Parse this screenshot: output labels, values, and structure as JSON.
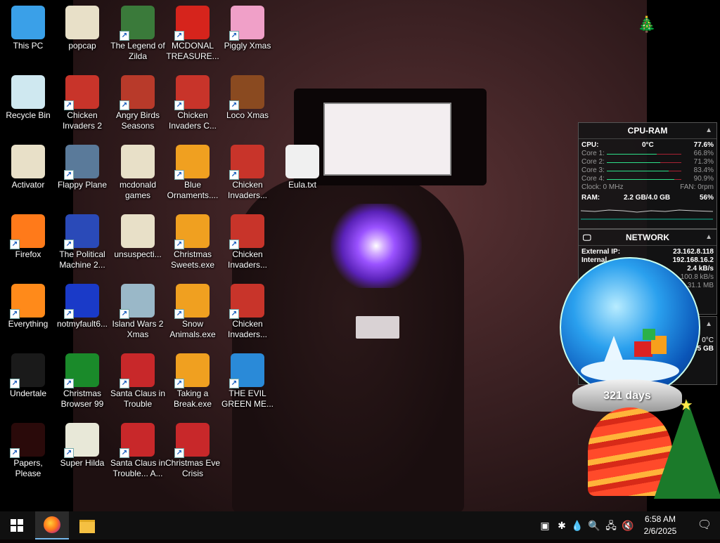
{
  "desktop": {
    "icons": [
      {
        "label": "This PC",
        "icon": "computer-icon"
      },
      {
        "label": "popcap",
        "icon": "folder-icon"
      },
      {
        "label": "The Legend of Zilda",
        "icon": "game-icon"
      },
      {
        "label": "MCDONAL TREASURE...",
        "icon": "mcdonalds-icon"
      },
      {
        "label": "Piggly Xmas",
        "icon": "pig-icon"
      },
      {
        "label": "Recycle Bin",
        "icon": "recycle-bin-icon"
      },
      {
        "label": "Chicken Invaders 2",
        "icon": "chicken-icon"
      },
      {
        "label": "Angry Birds Seasons",
        "icon": "angry-birds-icon"
      },
      {
        "label": "Chicken Invaders C...",
        "icon": "chicken-icon"
      },
      {
        "label": "Loco Xmas",
        "icon": "bear-icon"
      },
      {
        "label": "Activator",
        "icon": "folder-icon"
      },
      {
        "label": "Flappy Plane",
        "icon": "plane-icon"
      },
      {
        "label": "mcdonald games",
        "icon": "folder-icon"
      },
      {
        "label": "Blue Ornaments....",
        "icon": "exe-icon"
      },
      {
        "label": "Chicken Invaders...",
        "icon": "chicken-icon"
      },
      {
        "label": "Eula.txt",
        "icon": "text-file-icon"
      },
      {
        "label": "Firefox",
        "icon": "firefox-icon"
      },
      {
        "label": "The Political Machine 2...",
        "icon": "political-machine-icon"
      },
      {
        "label": "unsuspecti...",
        "icon": "folder-icon"
      },
      {
        "label": "Christmas Sweets.exe",
        "icon": "exe-icon"
      },
      {
        "label": "Chicken Invaders...",
        "icon": "chicken-icon"
      },
      {
        "label": "Everything",
        "icon": "search-magnifier-icon"
      },
      {
        "label": "notmyfault6...",
        "icon": "bsod-icon"
      },
      {
        "label": "Island Wars 2 Xmas",
        "icon": "island-icon"
      },
      {
        "label": "Snow Animals.exe",
        "icon": "exe-icon"
      },
      {
        "label": "Chicken Invaders...",
        "icon": "chicken-icon"
      },
      {
        "label": "Undertale",
        "icon": "undertale-icon"
      },
      {
        "label": "Christmas Browser 99",
        "icon": "christmas-tree-icon"
      },
      {
        "label": "Santa Claus in Trouble",
        "icon": "santa-icon"
      },
      {
        "label": "Taking a Break.exe",
        "icon": "exe-icon"
      },
      {
        "label": "THE EVIL GREEN ME...",
        "icon": "messenger-icon"
      },
      {
        "label": "Papers, Please",
        "icon": "papers-please-icon"
      },
      {
        "label": "Super Hilda",
        "icon": "pixel-icon"
      },
      {
        "label": "Santa Claus in Trouble... A...",
        "icon": "santa-icon"
      },
      {
        "label": "Christmas Eve Crisis",
        "icon": "santa-icon"
      }
    ]
  },
  "cpu_widget": {
    "title": "CPU-RAM",
    "cpu_label": "CPU:",
    "cpu_temp": "0°C",
    "cpu_value": "77.6%",
    "cores": [
      {
        "label": "Core 1:",
        "value": "66.8%",
        "level": 0.668
      },
      {
        "label": "Core 2:",
        "value": "71.3%",
        "level": 0.713
      },
      {
        "label": "Core 3:",
        "value": "83.4%",
        "level": 0.834
      },
      {
        "label": "Core 4:",
        "value": "90.9%",
        "level": 0.909
      }
    ],
    "clock_label": "Clock: 0 MHz",
    "fan_label": "FAN: 0rpm",
    "ram_label": "RAM:",
    "ram_value": "2.2 GB/4.0 GB",
    "ram_percent": "56%"
  },
  "network_widget": {
    "title": "NETWORK",
    "external_ip_label": "External IP:",
    "external_ip": "23.162.8.118",
    "internal_label": "Internal",
    "internal_ip": "192.168.16.2",
    "speed_up": "2.4 kB/s",
    "speed_down": "100.8 kB/s",
    "total": "31.1 MB"
  },
  "hidden_widget": {
    "temp": "0°C",
    "size": "9.5 GB"
  },
  "globe": {
    "days": "321 days"
  },
  "taskbar": {
    "start_icon": "windows-start-icon",
    "apps": [
      {
        "name": "Firefox",
        "icon": "firefox-icon",
        "active": true
      },
      {
        "name": "File Explorer",
        "icon": "folder-icon",
        "active": false
      }
    ],
    "time": "6:58 AM",
    "date": "2/6/2025"
  },
  "colors": {
    "taskbar": "#101010",
    "accent": "#76b9ed",
    "widget_bar": "#aa2233",
    "widget_fill": "#2ee08a"
  }
}
